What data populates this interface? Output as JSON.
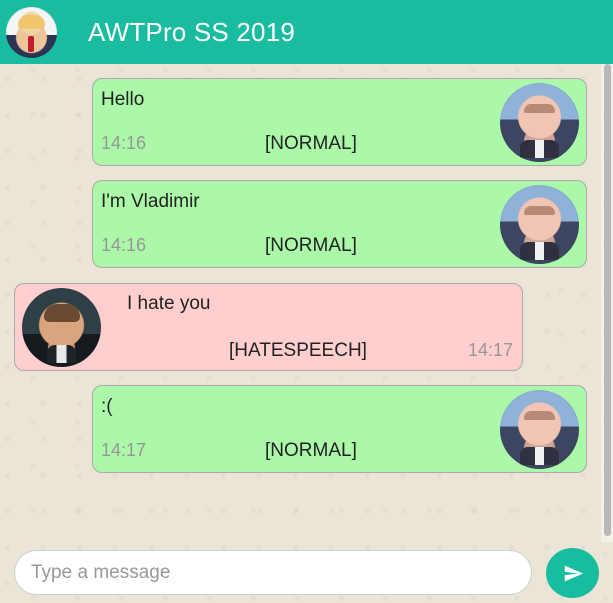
{
  "header": {
    "title": "AWTPro SS 2019"
  },
  "messages": [
    {
      "text": "Hello",
      "time": "14:16",
      "label": "[NORMAL]",
      "avatar": "putin-avatar"
    },
    {
      "text": "I'm Vladimir",
      "time": "14:16",
      "label": "[NORMAL]",
      "avatar": "putin-avatar"
    },
    {
      "text": "I hate you",
      "time": "14:17",
      "label": "[HATESPEECH]",
      "avatar": "kennedy-avatar"
    },
    {
      "text": ":(",
      "time": "14:17",
      "label": "[NORMAL]",
      "avatar": "putin-avatar"
    }
  ],
  "composer": {
    "placeholder": "Type a message",
    "send_icon": "send-icon"
  },
  "colors": {
    "header": "#19bc9f",
    "normal_message": "#abf8a9",
    "hatespeech_message": "#ffcfcf",
    "send_button": "#18bc9f"
  }
}
